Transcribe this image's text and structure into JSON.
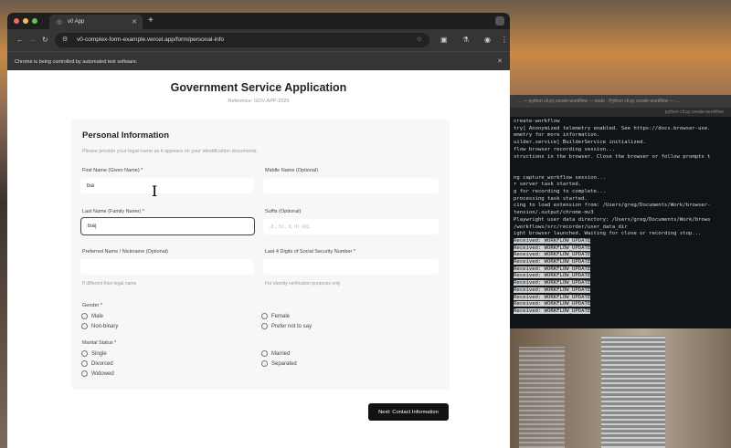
{
  "browser": {
    "tab_title": "v0 App",
    "url": "v0-complex-form-example.vercel.app/form/personal-info",
    "automation_notice": "Chrome is being controlled by automated test software."
  },
  "page": {
    "title": "Government Service Application",
    "reference": "Reference: GOV-APP-2025"
  },
  "section": {
    "title": "Personal Information",
    "description": "Please provide your legal name as it appears on your identification documents."
  },
  "fields": {
    "first_name": {
      "label": "First Name (Given Name) *",
      "value": "bia"
    },
    "middle_name": {
      "label": "Middle Name (Optional)",
      "value": ""
    },
    "last_name": {
      "label": "Last Name (Family Name) *",
      "value": "bia|"
    },
    "suffix": {
      "label": "Suffix (Optional)",
      "placeholder": "Jr., Sr., II, III, etc."
    },
    "preferred_name": {
      "label": "Preferred Name / Nickname (Optional)",
      "help": "If different from legal name"
    },
    "ssn_last4": {
      "label": "Last 4 Digits of Social Security Number *",
      "help": "For identity verification purposes only"
    }
  },
  "gender": {
    "label": "Gender *",
    "options": [
      "Male",
      "Female",
      "Non-binary",
      "Prefer not to say"
    ]
  },
  "marital": {
    "label": "Marital Status *",
    "options": [
      "Single",
      "Married",
      "Divorced",
      "Separated",
      "Widowed"
    ]
  },
  "next_button": "Next: Contact Information",
  "terminal": {
    "title": "… — python cli.py create-workflow — node · Python cli.py create-workflow — …",
    "tab": "python cli.py create-workflow",
    "lines": [
      "create-workflow",
      "try] Anonymized telemetry enabled. See https://docs.browser-use.",
      "emetry for more information.",
      "uilder.service] BuilderService initialized.",
      "flow browser recording session...",
      "structions in the browser. Close the browser or follow prompts t",
      "",
      "",
      "ng capture_workflow session...",
      "r server task started.",
      "g for recording to complete...",
      "processing task started.",
      "cing to load extension from: /Users/greg/Documents/Work/browser-",
      "tension/.output/chrome-mv3",
      "Playwright user data directory: /Users/greg/Documents/Work/brows",
      "/workflows/src/recorder/user_data_dir",
      "ight browser launched. Waiting for close or recording stop..."
    ],
    "received_prefix": "Received:",
    "received_msg": "WORKFLOW_UPDATE",
    "received_count": 11
  },
  "colors": {
    "accent": "#111111",
    "terminal_bg": "#0f1418"
  }
}
